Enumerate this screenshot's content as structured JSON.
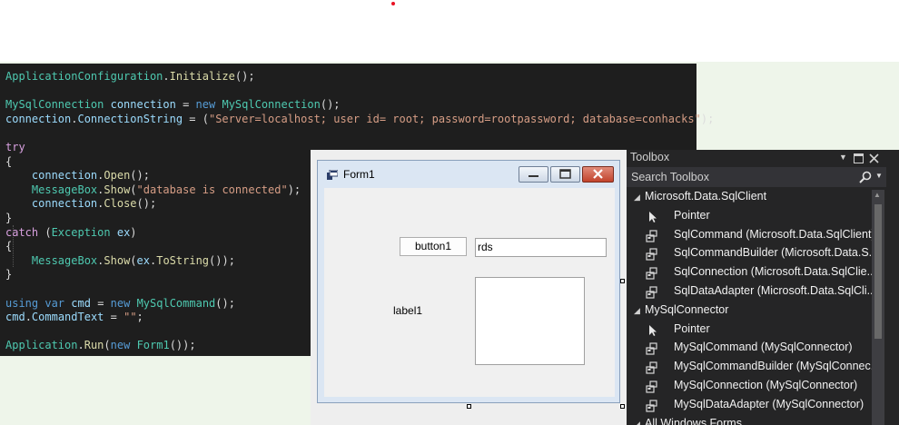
{
  "code": {
    "lines": [
      [
        [
          "ApplicationConfiguration",
          "type"
        ],
        [
          ".",
          "pl"
        ],
        [
          "Initialize",
          "fn"
        ],
        [
          "();",
          "pl"
        ]
      ],
      [],
      [
        [
          "MySqlConnection",
          "type"
        ],
        [
          " ",
          "pl"
        ],
        [
          "connection",
          "var"
        ],
        [
          " = ",
          "pl"
        ],
        [
          "new",
          "kw"
        ],
        [
          " ",
          "pl"
        ],
        [
          "MySqlConnection",
          "type"
        ],
        [
          "();",
          "pl"
        ]
      ],
      [
        [
          "connection",
          "var"
        ],
        [
          ".",
          "pl"
        ],
        [
          "ConnectionString",
          "var"
        ],
        [
          " = (",
          "pl"
        ],
        [
          "\"Server=localhost; user id= root; password=rootpassword; database=conhacks\"",
          "str"
        ],
        [
          ");",
          "pl"
        ]
      ],
      [],
      [
        [
          "try",
          "ctl"
        ]
      ],
      [
        [
          "{",
          "pl"
        ]
      ],
      [
        [
          "    ",
          "pl"
        ],
        [
          "connection",
          "var"
        ],
        [
          ".",
          "pl"
        ],
        [
          "Open",
          "fn"
        ],
        [
          "();",
          "pl"
        ]
      ],
      [
        [
          "    ",
          "pl"
        ],
        [
          "MessageBox",
          "type"
        ],
        [
          ".",
          "pl"
        ],
        [
          "Show",
          "fn"
        ],
        [
          "(",
          "pl"
        ],
        [
          "\"database is connected\"",
          "str"
        ],
        [
          ");",
          "pl"
        ]
      ],
      [
        [
          "    ",
          "pl"
        ],
        [
          "connection",
          "var"
        ],
        [
          ".",
          "pl"
        ],
        [
          "Close",
          "fn"
        ],
        [
          "();",
          "pl"
        ]
      ],
      [
        [
          "}",
          "pl"
        ]
      ],
      [
        [
          "catch",
          "ctl"
        ],
        [
          " (",
          "pl"
        ],
        [
          "Exception",
          "type"
        ],
        [
          " ",
          "pl"
        ],
        [
          "ex",
          "var"
        ],
        [
          ")",
          "pl"
        ]
      ],
      [
        [
          "{",
          "pl"
        ]
      ],
      [
        [
          "    ",
          "pl"
        ],
        [
          "MessageBox",
          "type"
        ],
        [
          ".",
          "pl"
        ],
        [
          "Show",
          "fn"
        ],
        [
          "(",
          "pl"
        ],
        [
          "ex",
          "var"
        ],
        [
          ".",
          "pl"
        ],
        [
          "ToString",
          "fn"
        ],
        [
          "());",
          "pl"
        ]
      ],
      [
        [
          "}",
          "pl"
        ]
      ],
      [],
      [
        [
          "using",
          "kw"
        ],
        [
          " ",
          "pl"
        ],
        [
          "var",
          "kw"
        ],
        [
          " ",
          "pl"
        ],
        [
          "cmd",
          "var"
        ],
        [
          " = ",
          "pl"
        ],
        [
          "new",
          "kw"
        ],
        [
          " ",
          "pl"
        ],
        [
          "MySqlCommand",
          "type"
        ],
        [
          "();",
          "pl"
        ]
      ],
      [
        [
          "cmd",
          "var"
        ],
        [
          ".",
          "pl"
        ],
        [
          "CommandText",
          "var"
        ],
        [
          " = ",
          "pl"
        ],
        [
          "\"\"",
          "str"
        ],
        [
          ";",
          "pl"
        ]
      ],
      [],
      [
        [
          "Application",
          "type"
        ],
        [
          ".",
          "pl"
        ],
        [
          "Run",
          "fn"
        ],
        [
          "(",
          "pl"
        ],
        [
          "new",
          "kw"
        ],
        [
          " ",
          "pl"
        ],
        [
          "Form1",
          "type"
        ],
        [
          "());",
          "pl"
        ]
      ]
    ]
  },
  "form": {
    "title": "Form1",
    "button_label": "button1",
    "textbox_value": "rds",
    "label_text": "label1"
  },
  "toolbox": {
    "title": "Toolbox",
    "header_icons": [
      "dropdown-icon",
      "maximize-icon",
      "close-icon"
    ],
    "search_placeholder": "Search Toolbox",
    "rows": [
      {
        "kind": "group",
        "label": "Microsoft.Data.SqlClient"
      },
      {
        "kind": "item",
        "icon": "pointer",
        "label": "Pointer"
      },
      {
        "kind": "item",
        "icon": "component",
        "label": "SqlCommand (Microsoft.Data.SqlClient)"
      },
      {
        "kind": "item",
        "icon": "component",
        "label": "SqlCommandBuilder (Microsoft.Data.S..."
      },
      {
        "kind": "item",
        "icon": "component",
        "label": "SqlConnection (Microsoft.Data.SqlClie..."
      },
      {
        "kind": "item",
        "icon": "component",
        "label": "SqlDataAdapter (Microsoft.Data.SqlCli..."
      },
      {
        "kind": "group",
        "label": "MySqlConnector"
      },
      {
        "kind": "item",
        "icon": "pointer",
        "label": "Pointer"
      },
      {
        "kind": "item",
        "icon": "component",
        "label": "MySqlCommand (MySqlConnector)"
      },
      {
        "kind": "item",
        "icon": "component",
        "label": "MySqlCommandBuilder (MySqlConnec..."
      },
      {
        "kind": "item",
        "icon": "component",
        "label": "MySqlConnection (MySqlConnector)"
      },
      {
        "kind": "item",
        "icon": "component",
        "label": "MySqlDataAdapter (MySqlConnector)"
      },
      {
        "kind": "group",
        "label": "All Windows Forms"
      }
    ]
  }
}
